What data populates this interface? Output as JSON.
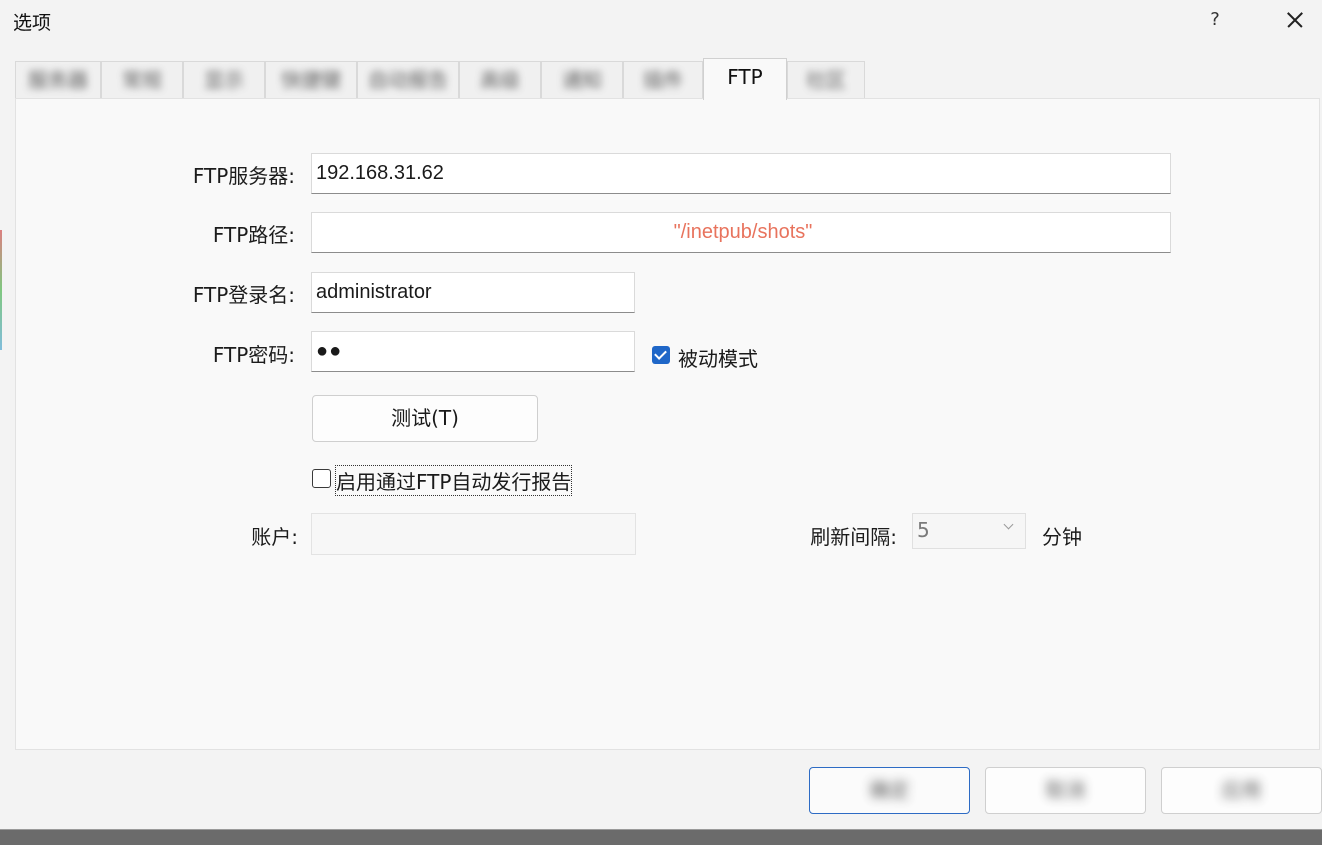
{
  "window": {
    "title": "选项",
    "help_glyph": "?"
  },
  "tabs": [
    {
      "label": "服务器",
      "state": "blurred"
    },
    {
      "label": "常规",
      "state": "blurred"
    },
    {
      "label": "显示",
      "state": "blurred"
    },
    {
      "label": "快捷键",
      "state": "blurred"
    },
    {
      "label": "自动报告",
      "state": "blurred"
    },
    {
      "label": "高级",
      "state": "blurred"
    },
    {
      "label": "通知",
      "state": "blurred"
    },
    {
      "label": "插件",
      "state": "blurred"
    },
    {
      "label": "FTP",
      "state": "active"
    },
    {
      "label": "社区",
      "state": "blurred"
    }
  ],
  "ftp": {
    "server_label": "FTP服务器:",
    "server_value": "192.168.31.62",
    "path_label": "FTP路径:",
    "path_value": "\"/inetpub/shots\"",
    "login_label": "FTP登录名:",
    "login_value": "administrator",
    "password_label": "FTP密码:",
    "password_value": "●●",
    "passive_label": "被动模式",
    "passive_checked": true,
    "test_button": "测试(T)",
    "auto_report_label": "启用通过FTP自动发行报告",
    "auto_report_checked": false,
    "account_label": "账户:",
    "account_value": "",
    "refresh_label": "刷新间隔:",
    "refresh_value": "5",
    "refresh_unit": "分钟"
  },
  "footer": {
    "ok_button": "确定",
    "cancel_button": "取消",
    "apply_button": "应用"
  },
  "colors": {
    "accent": "#1f67c8",
    "path_text": "#e8735d",
    "window_bg": "#f3f3f3",
    "panel_bg": "#f9f9f9"
  }
}
